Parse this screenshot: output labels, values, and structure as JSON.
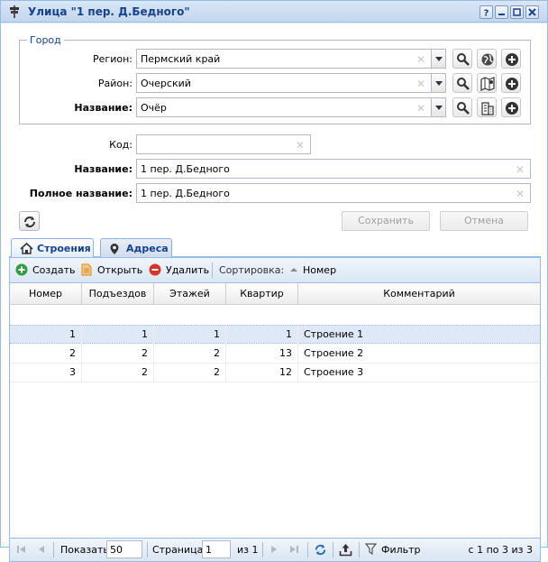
{
  "window": {
    "title": "Улица \"1 пер. Д.Бедного\""
  },
  "city": {
    "legend": "Город",
    "region_label": "Регион:",
    "region_value": "Пермский край",
    "district_label": "Район:",
    "district_value": "Очерский",
    "name_label": "Название:",
    "name_value": "Очёр"
  },
  "street": {
    "code_label": "Код:",
    "code_value": "",
    "name_label": "Название:",
    "name_value": "1 пер. Д.Бедного",
    "fullname_label": "Полное название:",
    "fullname_value": "1 пер. Д.Бедного"
  },
  "actions": {
    "save_label": "Сохранить",
    "cancel_label": "Отмена"
  },
  "tabs": [
    {
      "label": "Строения",
      "icon": "home-icon"
    },
    {
      "label": "Адреса",
      "icon": "map-pin-icon"
    }
  ],
  "toolbar": {
    "create_label": "Создать",
    "open_label": "Открыть",
    "delete_label": "Удалить",
    "sort_label": "Сортировка:",
    "sort_field": "Номер"
  },
  "grid": {
    "columns": [
      "Номер",
      "Подъездов",
      "Этажей",
      "Квартир",
      "Комментарий"
    ],
    "rows": [
      {
        "number": "1",
        "entrances": "1",
        "floors": "1",
        "apartments": "1",
        "comment": "Строение 1"
      },
      {
        "number": "2",
        "entrances": "2",
        "floors": "2",
        "apartments": "13",
        "comment": "Строение 2"
      },
      {
        "number": "3",
        "entrances": "2",
        "floors": "2",
        "apartments": "12",
        "comment": "Строение 3"
      }
    ]
  },
  "pager": {
    "show_label": "Показать",
    "page_size": "50",
    "page_label": "Страница",
    "page_value": "1",
    "of_label": "из 1",
    "filter_label": "Фильтр",
    "summary": "с 1 по 3 из 3"
  },
  "colors": {
    "accent": "#15428b",
    "border": "#99bbe8",
    "selected_row": "#dfe8f6"
  }
}
